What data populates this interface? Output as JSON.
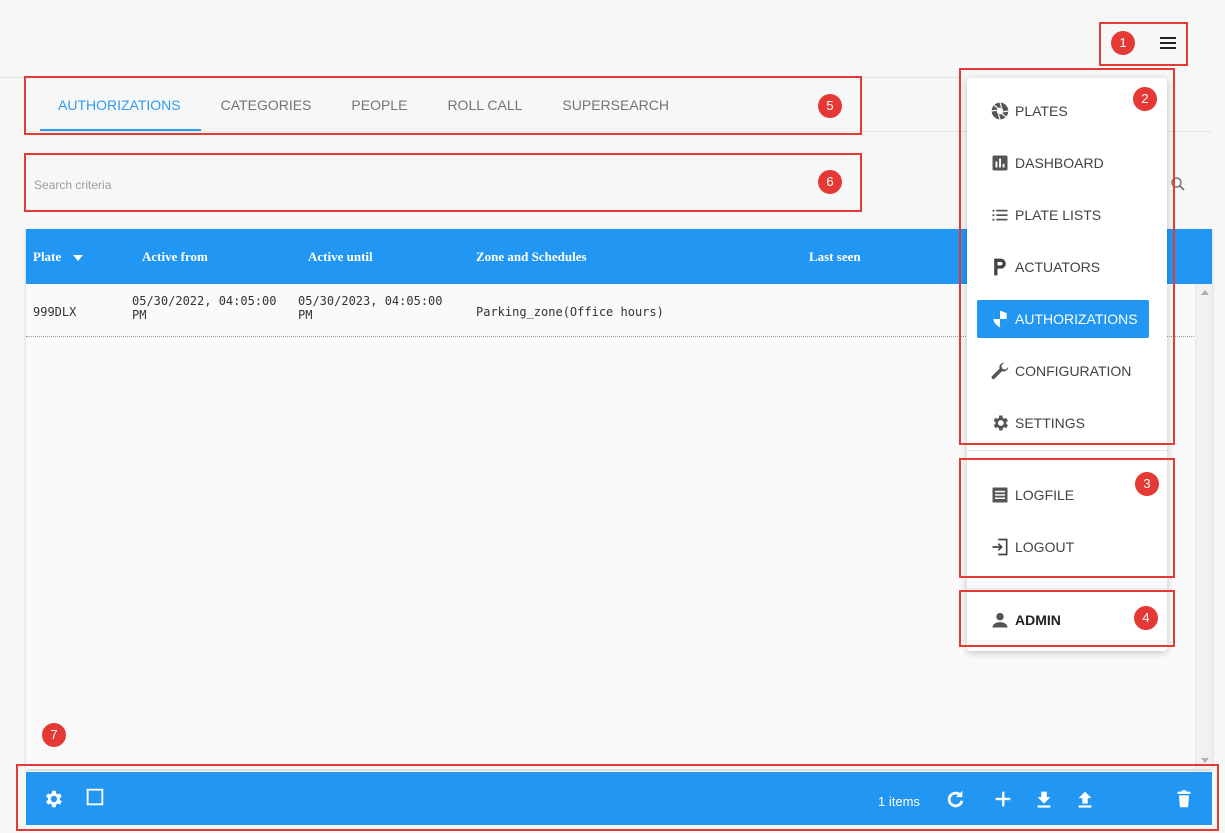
{
  "colors": {
    "primary": "#2196f3",
    "annotation": "#e53935"
  },
  "annotations": [
    "1",
    "2",
    "3",
    "4",
    "5",
    "6",
    "7"
  ],
  "tabs": [
    {
      "label": "AUTHORIZATIONS",
      "active": true
    },
    {
      "label": "CATEGORIES"
    },
    {
      "label": "PEOPLE"
    },
    {
      "label": "ROLL CALL"
    },
    {
      "label": "SUPERSEARCH"
    }
  ],
  "search": {
    "placeholder": "Search criteria",
    "icon": "search-icon"
  },
  "table": {
    "columns": [
      "Plate",
      "Active from",
      "Active until",
      "Zone and Schedules",
      "Last seen"
    ],
    "sort_column": "Plate",
    "rows": [
      {
        "plate": "999DLX",
        "active_from": "05/30/2022, 04:05:00 PM",
        "active_until": "05/30/2023, 04:05:00 PM",
        "zone": "Parking_zone(Office hours)",
        "last_seen": ""
      }
    ]
  },
  "footer": {
    "item_count": "1 items",
    "icons": [
      "gear-icon",
      "checkbox-icon",
      "refresh-icon",
      "add-icon",
      "download-icon",
      "upload-icon",
      "trash-icon"
    ]
  },
  "menu": {
    "main": [
      {
        "label": "PLATES",
        "icon": "aperture-icon"
      },
      {
        "label": "DASHBOARD",
        "icon": "bar-chart-icon"
      },
      {
        "label": "PLATE LISTS",
        "icon": "list-icon"
      },
      {
        "label": "ACTUATORS",
        "icon": "parking-icon"
      },
      {
        "label": "AUTHORIZATIONS",
        "icon": "shield-icon",
        "active": true
      },
      {
        "label": "CONFIGURATION",
        "icon": "wrench-icon"
      },
      {
        "label": "SETTINGS",
        "icon": "gear-icon"
      }
    ],
    "system": [
      {
        "label": "LOGFILE",
        "icon": "logfile-icon"
      },
      {
        "label": "LOGOUT",
        "icon": "logout-icon"
      }
    ],
    "user": {
      "label": "ADMIN",
      "icon": "person-icon"
    }
  }
}
